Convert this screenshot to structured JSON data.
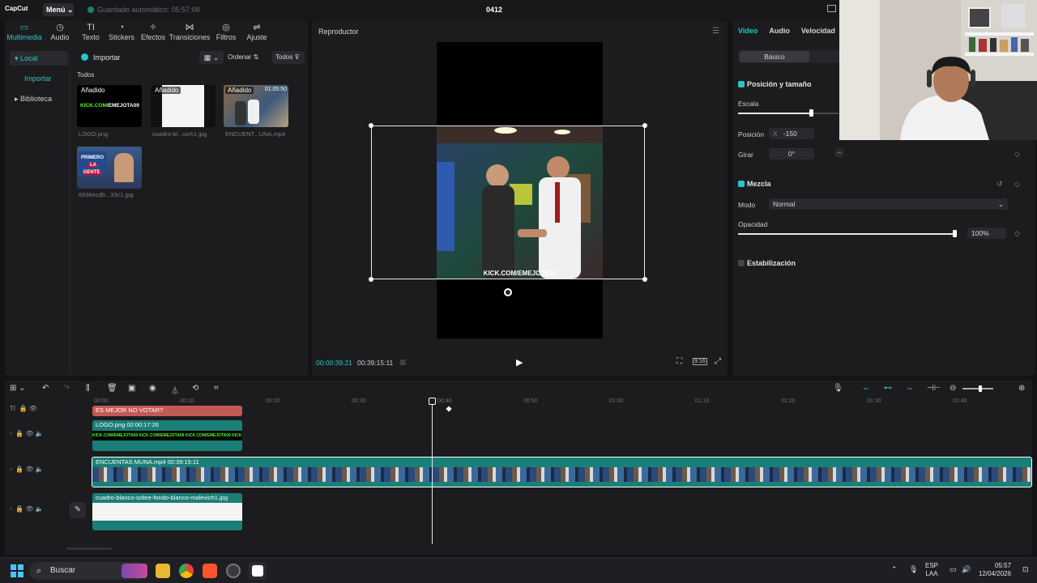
{
  "titlebar": {
    "logo": "CapCut",
    "menu": "Menú",
    "autosave": "Guardado automático: 05:57:08",
    "project": "0412"
  },
  "media": {
    "tabs": [
      {
        "label": "Multimedia",
        "icon": "media-icon",
        "active": true
      },
      {
        "label": "Audio",
        "icon": "audio-icon"
      },
      {
        "label": "Texto",
        "icon": "text-icon"
      },
      {
        "label": "Stickers",
        "icon": "sticker-icon"
      },
      {
        "label": "Efectos",
        "icon": "effects-icon"
      },
      {
        "label": "Transiciones",
        "icon": "transitions-icon"
      },
      {
        "label": "Filtros",
        "icon": "filters-icon"
      },
      {
        "label": "Ajuste",
        "icon": "adjust-icon"
      }
    ],
    "nav": {
      "local": "Local",
      "importar": "Importar",
      "biblioteca": "Biblioteca"
    },
    "import_label": "Importar",
    "sort_label": "Ordenar",
    "filter_label": "Todos",
    "all_label": "Todos",
    "items": [
      {
        "name": "LOGO.png",
        "badge": "Añadido",
        "overlay": "KICK.COM/EMEJOTA09"
      },
      {
        "name": "cuadro-bl...vich1.jpg",
        "badge": "Añadido"
      },
      {
        "name": "ENCUENT...UNA.mp4",
        "badge": "Añadido",
        "duration": "01:05:50"
      },
      {
        "name": "6936ecdb...33c1.jpg",
        "overlay": "PRIMERO LA GENTE"
      }
    ]
  },
  "player": {
    "title": "Reproductor",
    "watermark": "KICK.COM/EMEJOTA09",
    "current_time": "00:00:39:21",
    "total_time": "00:39:15:11",
    "ratio": "9:16"
  },
  "props": {
    "tabs": [
      "Video",
      "Audio",
      "Velocidad"
    ],
    "subtab": "Básico",
    "pos_size": "Posición y tamaño",
    "scale_label": "Escala",
    "scale_fraction": 0.85,
    "position_label": "Posición",
    "x_label": "X",
    "x_value": "-150",
    "rotate_label": "Girar",
    "rotate_value": "0°",
    "blend": "Mezcla",
    "mode_label": "Modo",
    "mode_value": "Normal",
    "opacity_label": "Opacidad",
    "opacity_value": "100%",
    "stabilize": "Estabilización"
  },
  "timeline": {
    "ticks": [
      "00:00",
      "00:10",
      "00:20",
      "00:30",
      "00:40",
      "00:50",
      "01:00",
      "01:10",
      "01:20",
      "01:30",
      "01:40"
    ],
    "text_clip": "ES MEJOR NO VOTAR?",
    "logo_clip": "LOGO.png  00:00:17:26",
    "main_clip": "ENCUENTAS MUNA.mp4  00:39:15:11",
    "bg_clip": "cuadro-blanco-sobre-fondo-blanco-malevich1.jpg"
  },
  "taskbar": {
    "search": "Buscar",
    "lang1": "ESP",
    "lang2": "LAA",
    "time": "05:57",
    "date": "12/04/2026"
  },
  "colors": {
    "accent": "#26c7c8",
    "text_clip": "#c45a55",
    "teal_clip": "#1a7f76"
  }
}
